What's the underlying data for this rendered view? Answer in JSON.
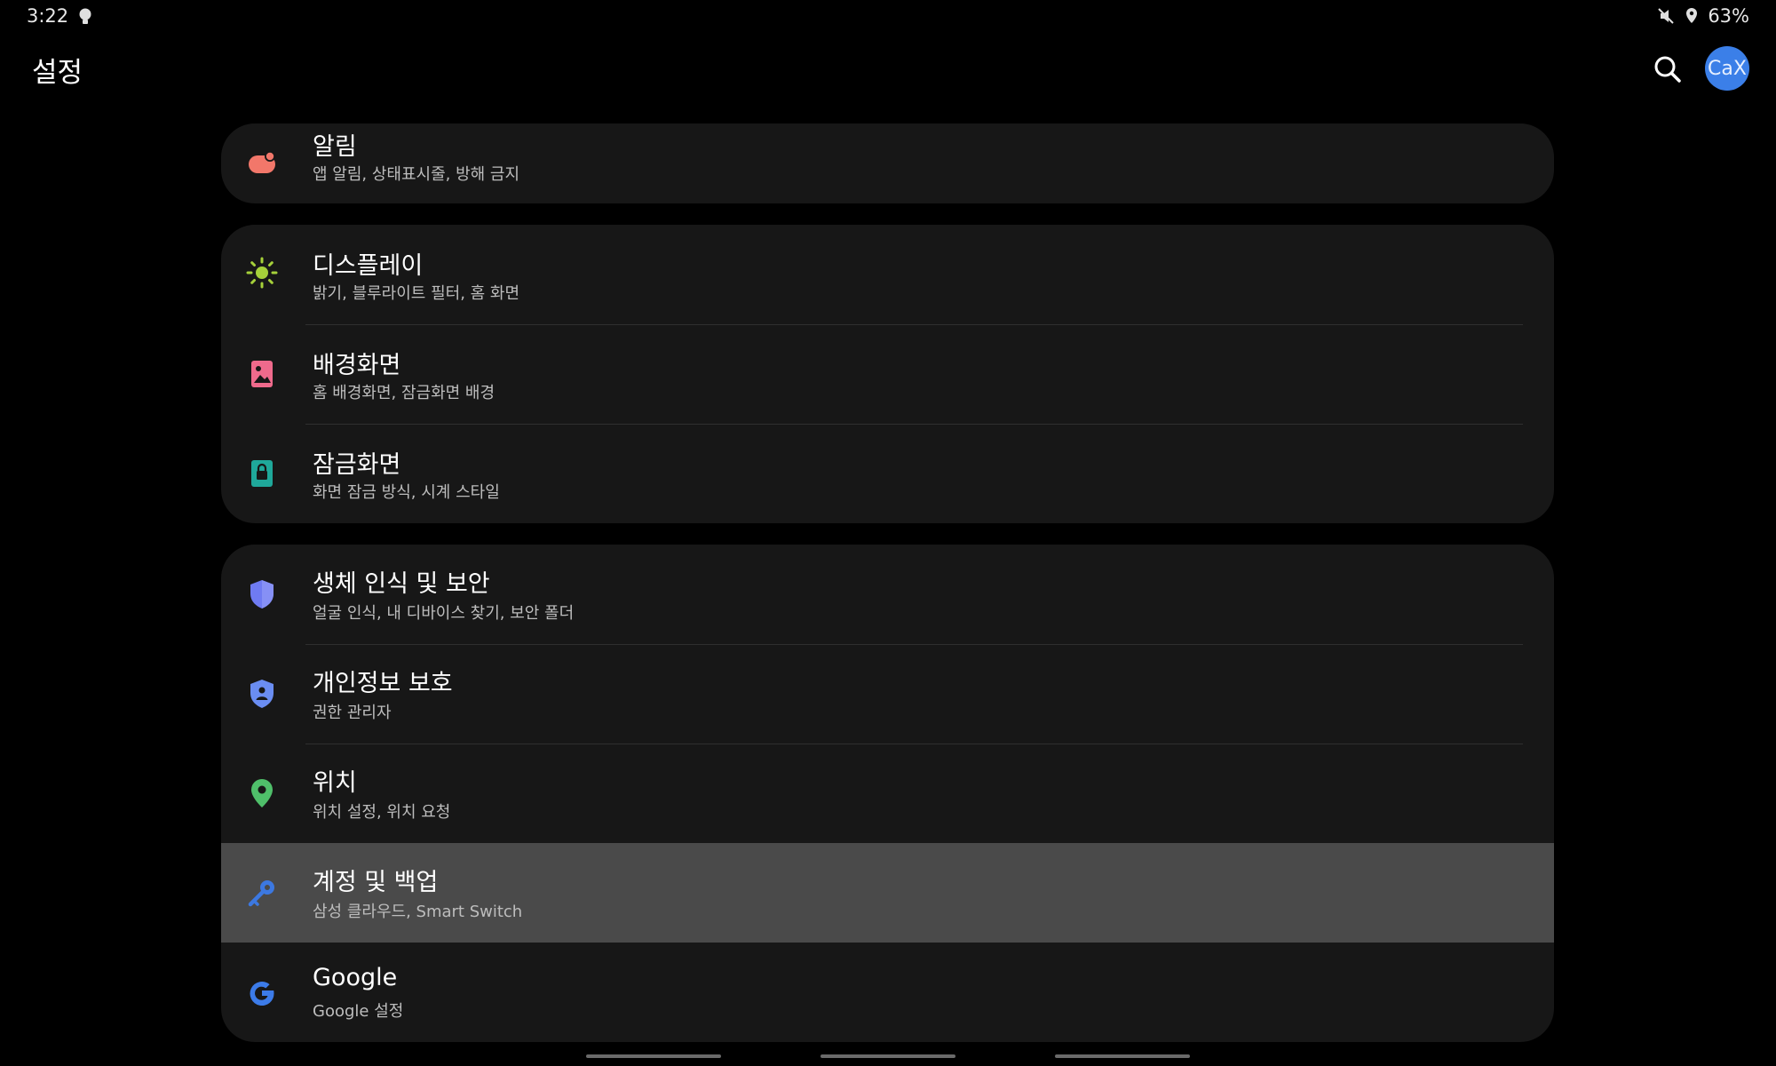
{
  "status_bar": {
    "time": "3:22",
    "battery": "63%",
    "icons": [
      "bulb-icon",
      "mute-icon",
      "location-icon"
    ]
  },
  "app_bar": {
    "title": "설정",
    "search_icon": "search-icon",
    "avatar_text": "CaX"
  },
  "colors": {
    "card_bg": "#171717",
    "highlight_bg": "#4a4a4a",
    "notifications": "#f2776a",
    "display": "#a6d13a",
    "wallpaper": "#ef6a8c",
    "lockscreen": "#1fa89a",
    "biometrics": "#6f7bf2",
    "privacy": "#6a8df2",
    "location": "#4fbf6a",
    "accounts": "#3c78e0",
    "google": "#3c7be8"
  },
  "groups": [
    {
      "items": [
        {
          "icon": "notification-icon",
          "title": "알림",
          "subtitle": "앱 알림, 상태표시줄, 방해 금지"
        }
      ]
    },
    {
      "items": [
        {
          "icon": "brightness-icon",
          "title": "디스플레이",
          "subtitle": "밝기, 블루라이트 필터, 홈 화면"
        },
        {
          "icon": "wallpaper-icon",
          "title": "배경화면",
          "subtitle": "홈 배경화면, 잠금화면 배경"
        },
        {
          "icon": "lock-icon",
          "title": "잠금화면",
          "subtitle": "화면 잠금 방식, 시계 스타일"
        }
      ]
    },
    {
      "items": [
        {
          "icon": "shield-icon",
          "title": "생체 인식 및 보안",
          "subtitle": "얼굴 인식, 내 디바이스 찾기, 보안 폴더"
        },
        {
          "icon": "privacy-shield-icon",
          "title": "개인정보 보호",
          "subtitle": "권한 관리자"
        },
        {
          "icon": "location-pin-icon",
          "title": "위치",
          "subtitle": "위치 설정, 위치 요청"
        },
        {
          "icon": "key-icon",
          "title": "계정 및 백업",
          "subtitle": "삼성 클라우드, Smart Switch"
        },
        {
          "icon": "google-icon",
          "title": "Google",
          "subtitle": "Google 설정"
        }
      ]
    }
  ]
}
